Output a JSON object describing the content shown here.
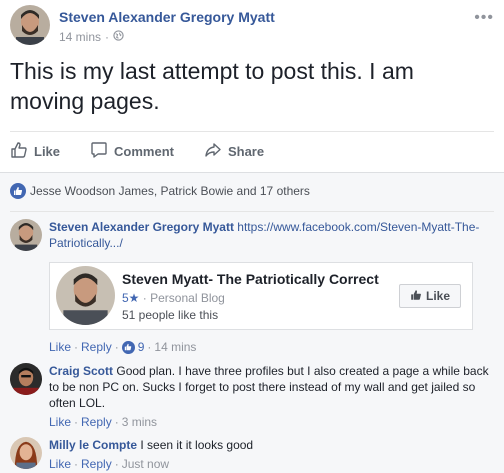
{
  "post": {
    "author": "Steven Alexander Gregory Myatt",
    "time": "14 mins",
    "dot": "·",
    "more": "•••",
    "text": "This is my last attempt to post this. I am moving pages."
  },
  "actions": {
    "like": "Like",
    "comment": "Comment",
    "share": "Share"
  },
  "reactions": {
    "summary": "Jesse Woodson James, Patrick Bowie and 17 others"
  },
  "comments": [
    {
      "author": "Steven Alexander Gregory Myatt",
      "text": "https://www.facebook.com/Steven-Myatt-The-Patriotically.../",
      "like": "Like",
      "reply": "Reply",
      "likes_count": "9",
      "time": "14 mins"
    },
    {
      "author": "Craig Scott",
      "text": "Good plan. I have three profiles but I also created a page a while back to be non PC on. Sucks I forget to post there instead of my wall and get jailed so often LOL.",
      "like": "Like",
      "reply": "Reply",
      "time": "3 mins"
    },
    {
      "author": "Milly le Compte",
      "text": "I seen it it looks good",
      "like": "Like",
      "reply": "Reply",
      "time": "Just now"
    }
  ],
  "card": {
    "title": "Steven Myatt- The Patriotically Correct",
    "rating": "5★",
    "category": "Personal Blog",
    "likes": "51 people like this",
    "button": "Like"
  },
  "colors": {
    "link": "#365899",
    "accent": "#4267b2",
    "muted": "#90949c"
  }
}
